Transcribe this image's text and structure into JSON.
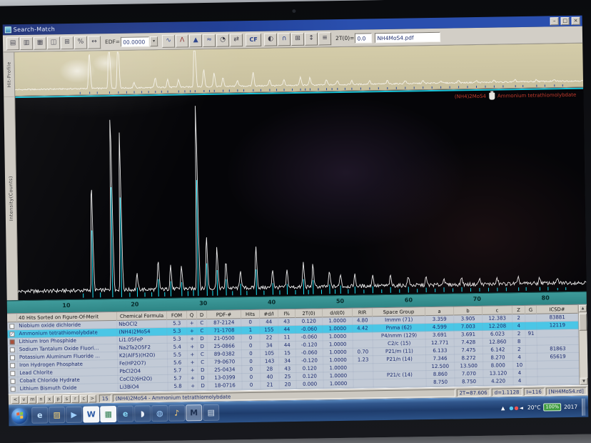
{
  "window": {
    "title": "Search-Match",
    "controls": {
      "minimize": "–",
      "maximize": "□",
      "close": "×"
    }
  },
  "toolbar": {
    "groups": [
      {
        "id": "tb-group1",
        "items": [
          {
            "name": "new-pattern-icon",
            "glyph": "▤"
          },
          {
            "name": "open-pattern-icon",
            "glyph": "▥"
          },
          {
            "name": "save-pattern-icon",
            "glyph": "▦"
          },
          {
            "name": "print-icon",
            "glyph": "◫"
          },
          {
            "name": "copy-icon",
            "glyph": "⊞"
          },
          {
            "name": "percent-scale-icon",
            "glyph": "%"
          },
          {
            "name": "expand-scale-icon",
            "glyph": "↔"
          }
        ]
      },
      {
        "id": "tb-group2",
        "items": [
          {
            "name": "profile-view-icon",
            "glyph": "∿",
            "color": "#28408a"
          },
          {
            "name": "peak-search-icon",
            "glyph": "Λ",
            "color": "#8a2828"
          },
          {
            "name": "background-icon",
            "glyph": "▲",
            "color": "#28408a"
          },
          {
            "name": "smooth-icon",
            "glyph": "≈",
            "color": "#28408a"
          },
          {
            "name": "zoom-icon",
            "glyph": "◔",
            "color": "#3a3a46"
          },
          {
            "name": "swap-axes-icon",
            "glyph": "⇄",
            "color": "#3a3a46"
          }
        ]
      },
      {
        "id": "tb-group3",
        "items": [
          {
            "name": "contrast-icon",
            "glyph": "◐",
            "color": "#3a3a46"
          },
          {
            "name": "peak-profile-icon",
            "glyph": "∩",
            "color": "#28408a"
          },
          {
            "name": "grid-icon",
            "glyph": "⊞",
            "color": "#3a3a46"
          },
          {
            "name": "scale-y-icon",
            "glyph": "↕",
            "color": "#3a3a46"
          },
          {
            "name": "list-icon",
            "glyph": "≡",
            "color": "#3a3a46"
          }
        ]
      }
    ],
    "edf_label": "EDF=",
    "edf_value": "00.0000",
    "edf_dropdown_glyph": "▾",
    "cf_label": "CF",
    "two_theta_label": "2T(0)=",
    "two_theta_value": "0.0",
    "filename": "NH4MoS4.pdf"
  },
  "strip": {
    "label": "Hit-Profile"
  },
  "plot": {
    "ylabel": "Intensity(Counts)",
    "phase_formula": "(NH4)2MoS4",
    "phase_name": "Ammonium tetrathiomolybdate"
  },
  "axis": {
    "range": [
      3,
      86
    ],
    "ticks": [
      10,
      20,
      30,
      40,
      50,
      60,
      70,
      80
    ]
  },
  "pattern": {
    "range": [
      3,
      86
    ],
    "peaks": [
      [
        13.9,
        58
      ],
      [
        16.8,
        95
      ],
      [
        18.1,
        86
      ],
      [
        20.4,
        8
      ],
      [
        23.5,
        15
      ],
      [
        25.3,
        13
      ],
      [
        26.9,
        12
      ],
      [
        29.3,
        100
      ],
      [
        30.6,
        28
      ],
      [
        32.1,
        22
      ],
      [
        33.4,
        14
      ],
      [
        35.5,
        10
      ],
      [
        37.8,
        22
      ],
      [
        40.2,
        10
      ],
      [
        42.3,
        9
      ],
      [
        44.7,
        13
      ],
      [
        46.1,
        12
      ],
      [
        48.5,
        8
      ],
      [
        50.1,
        7
      ],
      [
        52.2,
        6
      ],
      [
        54.8,
        6
      ],
      [
        57.4,
        5
      ],
      [
        60.0,
        5
      ],
      [
        62.6,
        4
      ],
      [
        65.2,
        4
      ],
      [
        67.8,
        4
      ],
      [
        70.4,
        3
      ],
      [
        73.0,
        3
      ],
      [
        76.1,
        3
      ],
      [
        79.2,
        3
      ],
      [
        81.8,
        2
      ]
    ],
    "ref_sticks": [
      [
        12.5,
        4
      ],
      [
        15.0,
        5
      ],
      [
        19.3,
        4
      ],
      [
        21.5,
        4
      ],
      [
        22.5,
        4
      ],
      [
        24.4,
        4
      ],
      [
        27.8,
        5
      ],
      [
        28.6,
        6
      ],
      [
        31.4,
        5
      ],
      [
        34.3,
        4
      ],
      [
        36.4,
        4
      ],
      [
        38.9,
        4
      ],
      [
        41.2,
        4
      ],
      [
        43.5,
        4
      ],
      [
        45.4,
        4
      ],
      [
        47.3,
        4
      ],
      [
        49.3,
        4
      ],
      [
        51.2,
        4
      ],
      [
        53.5,
        3
      ],
      [
        56.1,
        3
      ],
      [
        58.7,
        3
      ],
      [
        61.3,
        3
      ],
      [
        63.9,
        3
      ],
      [
        66.5,
        3
      ],
      [
        69.1,
        3
      ],
      [
        71.7,
        3
      ],
      [
        74.3,
        3
      ],
      [
        77.2,
        3
      ],
      [
        80.4,
        3
      ],
      [
        83.0,
        2
      ]
    ]
  },
  "table": {
    "check_glyph": "✓",
    "scroll_up": "▲",
    "scroll_down": "▼",
    "columns": [
      {
        "key": "chk",
        "label": ""
      },
      {
        "key": "name",
        "label": "40 Hits Sorted on Figure-Of-Merit"
      },
      {
        "key": "formula",
        "label": "Chemical Formula"
      },
      {
        "key": "fom",
        "label": "FOM"
      },
      {
        "key": "q",
        "label": "Q"
      },
      {
        "key": "d",
        "label": "D"
      },
      {
        "key": "pdf",
        "label": "PDF-#"
      },
      {
        "key": "hits",
        "label": "Hits"
      },
      {
        "key": "ndi",
        "label": "#d/I"
      },
      {
        "key": "ipct",
        "label": "I%"
      },
      {
        "key": "t0",
        "label": "2T(0)"
      },
      {
        "key": "dd0",
        "label": "d/d(0)"
      },
      {
        "key": "rir",
        "label": "RIR"
      },
      {
        "key": "sg",
        "label": "Space Group"
      },
      {
        "key": "a",
        "label": "a"
      },
      {
        "key": "b",
        "label": "b"
      },
      {
        "key": "c",
        "label": "c"
      },
      {
        "key": "z",
        "label": "Z"
      },
      {
        "key": "g",
        "label": "G"
      },
      {
        "key": "icsd",
        "label": "ICSD#"
      }
    ],
    "selected_index": 1,
    "rows": [
      {
        "checked": false,
        "name": "Niobium oxide dichloride",
        "formula": "NbOCl2",
        "fom": "5.3",
        "q": "+",
        "d": "C",
        "pdf": "87-2124",
        "hits": "0",
        "ndi": "44",
        "ipct": "43",
        "t0": "0.120",
        "dd0": "1.0000",
        "rir": "4.80",
        "sg": "Immm (71)",
        "a": "3.359",
        "b": "3.905",
        "c": "12.383",
        "z": "2",
        "g": "",
        "icsd": "83881"
      },
      {
        "checked": true,
        "name": "Ammonium tetrathiomolybdate",
        "formula": "(NH4)2MoS4",
        "fom": "5.3",
        "q": "+",
        "d": "C",
        "pdf": "71-1708",
        "hits": "1",
        "ndi": "155",
        "ipct": "44",
        "t0": "-0.060",
        "dd0": "1.0000",
        "rir": "4.42",
        "sg": "Pnma (62)",
        "a": "4.599",
        "b": "7.003",
        "c": "12.208",
        "z": "4",
        "g": "",
        "icsd": "12119"
      },
      {
        "checked": false,
        "marker": "#a84b35",
        "name": "Lithium Iron Phosphide",
        "formula": "Li1.05FeP",
        "fom": "5.3",
        "q": "+",
        "d": "D",
        "pdf": "21-0500",
        "hits": "0",
        "ndi": "22",
        "ipct": "11",
        "t0": "-0.060",
        "dd0": "1.0000",
        "rir": "",
        "sg": "P4/nmm (129)",
        "a": "3.691",
        "b": "3.691",
        "c": "6.023",
        "z": "2",
        "g": "91",
        "icsd": ""
      },
      {
        "checked": false,
        "name": "Sodium Tantalum Oxide Fluori...",
        "formula": "Na2Ta2O5F2",
        "fom": "5.4",
        "q": "+",
        "d": "D",
        "pdf": "25-0866",
        "hits": "0",
        "ndi": "34",
        "ipct": "44",
        "t0": "-0.120",
        "dd0": "1.0000",
        "rir": "",
        "sg": "C2/c (15)",
        "a": "12.771",
        "b": "7.428",
        "c": "12.860",
        "z": "8",
        "g": "",
        "icsd": ""
      },
      {
        "checked": false,
        "name": "Potassium Aluminum Fluoride ...",
        "formula": "K2(AlF5)(H2O)",
        "fom": "5.5",
        "q": "+",
        "d": "C",
        "pdf": "89-0382",
        "hits": "0",
        "ndi": "105",
        "ipct": "15",
        "t0": "-0.060",
        "dd0": "1.0000",
        "rir": "0.70",
        "sg": "P21/m (11)",
        "a": "6.133",
        "b": "7.475",
        "c": "6.142",
        "z": "2",
        "g": "",
        "icsd": "81863"
      },
      {
        "checked": false,
        "name": "Iron Hydrogen Phosphate",
        "formula": "Fe(HP2O7)",
        "fom": "5.6",
        "q": "+",
        "d": "C",
        "pdf": "79-0670",
        "hits": "0",
        "ndi": "143",
        "ipct": "34",
        "t0": "-0.120",
        "dd0": "1.0000",
        "rir": "1.23",
        "sg": "P21/n (14)",
        "a": "7.346",
        "b": "8.272",
        "c": "8.270",
        "z": "4",
        "g": "",
        "icsd": "65619"
      },
      {
        "checked": false,
        "name": "Lead Chlorite",
        "formula": "PbCl2O4",
        "fom": "5.7",
        "q": "+",
        "d": "D",
        "pdf": "25-0434",
        "hits": "0",
        "ndi": "28",
        "ipct": "43",
        "t0": "0.120",
        "dd0": "1.0000",
        "rir": "",
        "sg": "",
        "a": "12.500",
        "b": "13.500",
        "c": "8.000",
        "z": "10",
        "g": "",
        "icsd": ""
      },
      {
        "checked": false,
        "name": "Cobalt Chloride Hydrate",
        "formula": "CoCl2(6H2O)",
        "fom": "5.7",
        "q": "+",
        "d": "D",
        "pdf": "13-0399",
        "hits": "0",
        "ndi": "40",
        "ipct": "25",
        "t0": "0.120",
        "dd0": "1.0000",
        "rir": "",
        "sg": "P21/c (14)",
        "a": "8.860",
        "b": "7.070",
        "c": "13.120",
        "z": "4",
        "g": "",
        "icsd": ""
      },
      {
        "checked": false,
        "name": "Lithium Bismuth Oxide",
        "formula": "Li3BiO4",
        "fom": "5.8",
        "q": "+",
        "d": "D",
        "pdf": "18-0716",
        "hits": "0",
        "ndi": "21",
        "ipct": "20",
        "t0": "0.000",
        "dd0": "1.0000",
        "rir": "",
        "sg": "",
        "a": "8.750",
        "b": "8.750",
        "c": "4.220",
        "z": "4",
        "g": "",
        "icsd": ""
      }
    ]
  },
  "statusbar": {
    "buttons": [
      "<",
      "v",
      "m",
      "n",
      "x",
      "p",
      "s",
      "r",
      "c",
      ">"
    ],
    "count": "15",
    "message": "(NH4)2MoS4 - Ammonium tetrathiomolybdate",
    "two_theta": "2T=87.606",
    "d_value": "d=1.1128",
    "intensity": "I=116",
    "file": "[NH4MoS4.rd]"
  },
  "taskbar": {
    "icons": [
      {
        "name": "taskbar-browser-icon",
        "glyph": "e",
        "color": "#bfe2ff"
      },
      {
        "name": "taskbar-folder-icon",
        "glyph": "▨",
        "color": "#f5d37a"
      },
      {
        "name": "taskbar-media-player-icon",
        "glyph": "▶",
        "color": "#9fd0ff"
      },
      {
        "name": "taskbar-word-icon",
        "glyph": "W",
        "color": "#2b5aa6",
        "tile": true
      },
      {
        "name": "taskbar-spreadsheet-icon",
        "glyph": "▦",
        "color": "#2e7d4f",
        "tile": true
      },
      {
        "name": "taskbar-ie-icon",
        "glyph": "e",
        "color": "#86d6f4"
      },
      {
        "name": "taskbar-messenger-icon",
        "glyph": "◗",
        "color": "#e8eef6"
      },
      {
        "name": "taskbar-globe-icon",
        "glyph": "◍",
        "color": "#9fd0ff"
      },
      {
        "name": "taskbar-music-icon",
        "glyph": "♪",
        "color": "#ffd27a"
      },
      {
        "name": "taskbar-search-match-icon",
        "glyph": "M",
        "color": "#1e3050",
        "tile": true,
        "active": true
      },
      {
        "name": "taskbar-notepad-icon",
        "glyph": "▤",
        "color": "#d8e4f0"
      }
    ],
    "tray": {
      "expand": "▲",
      "items": [
        {
          "name": "tray-chat-icon",
          "glyph": "●",
          "color": "#5ac8f0"
        },
        {
          "name": "tray-alert-icon",
          "glyph": "●",
          "color": "#ef5350"
        },
        {
          "name": "tray-volume-icon",
          "glyph": "◄",
          "color": "#ffffff"
        }
      ],
      "temp": "20°C",
      "battery": "100%",
      "clock": "2017"
    }
  },
  "colors": {
    "highlight": "#4ac6e6",
    "stick": "#17dff2",
    "trace": "#ececec",
    "hitmark": "#2a4898",
    "phase_text": "#c23a2c"
  }
}
